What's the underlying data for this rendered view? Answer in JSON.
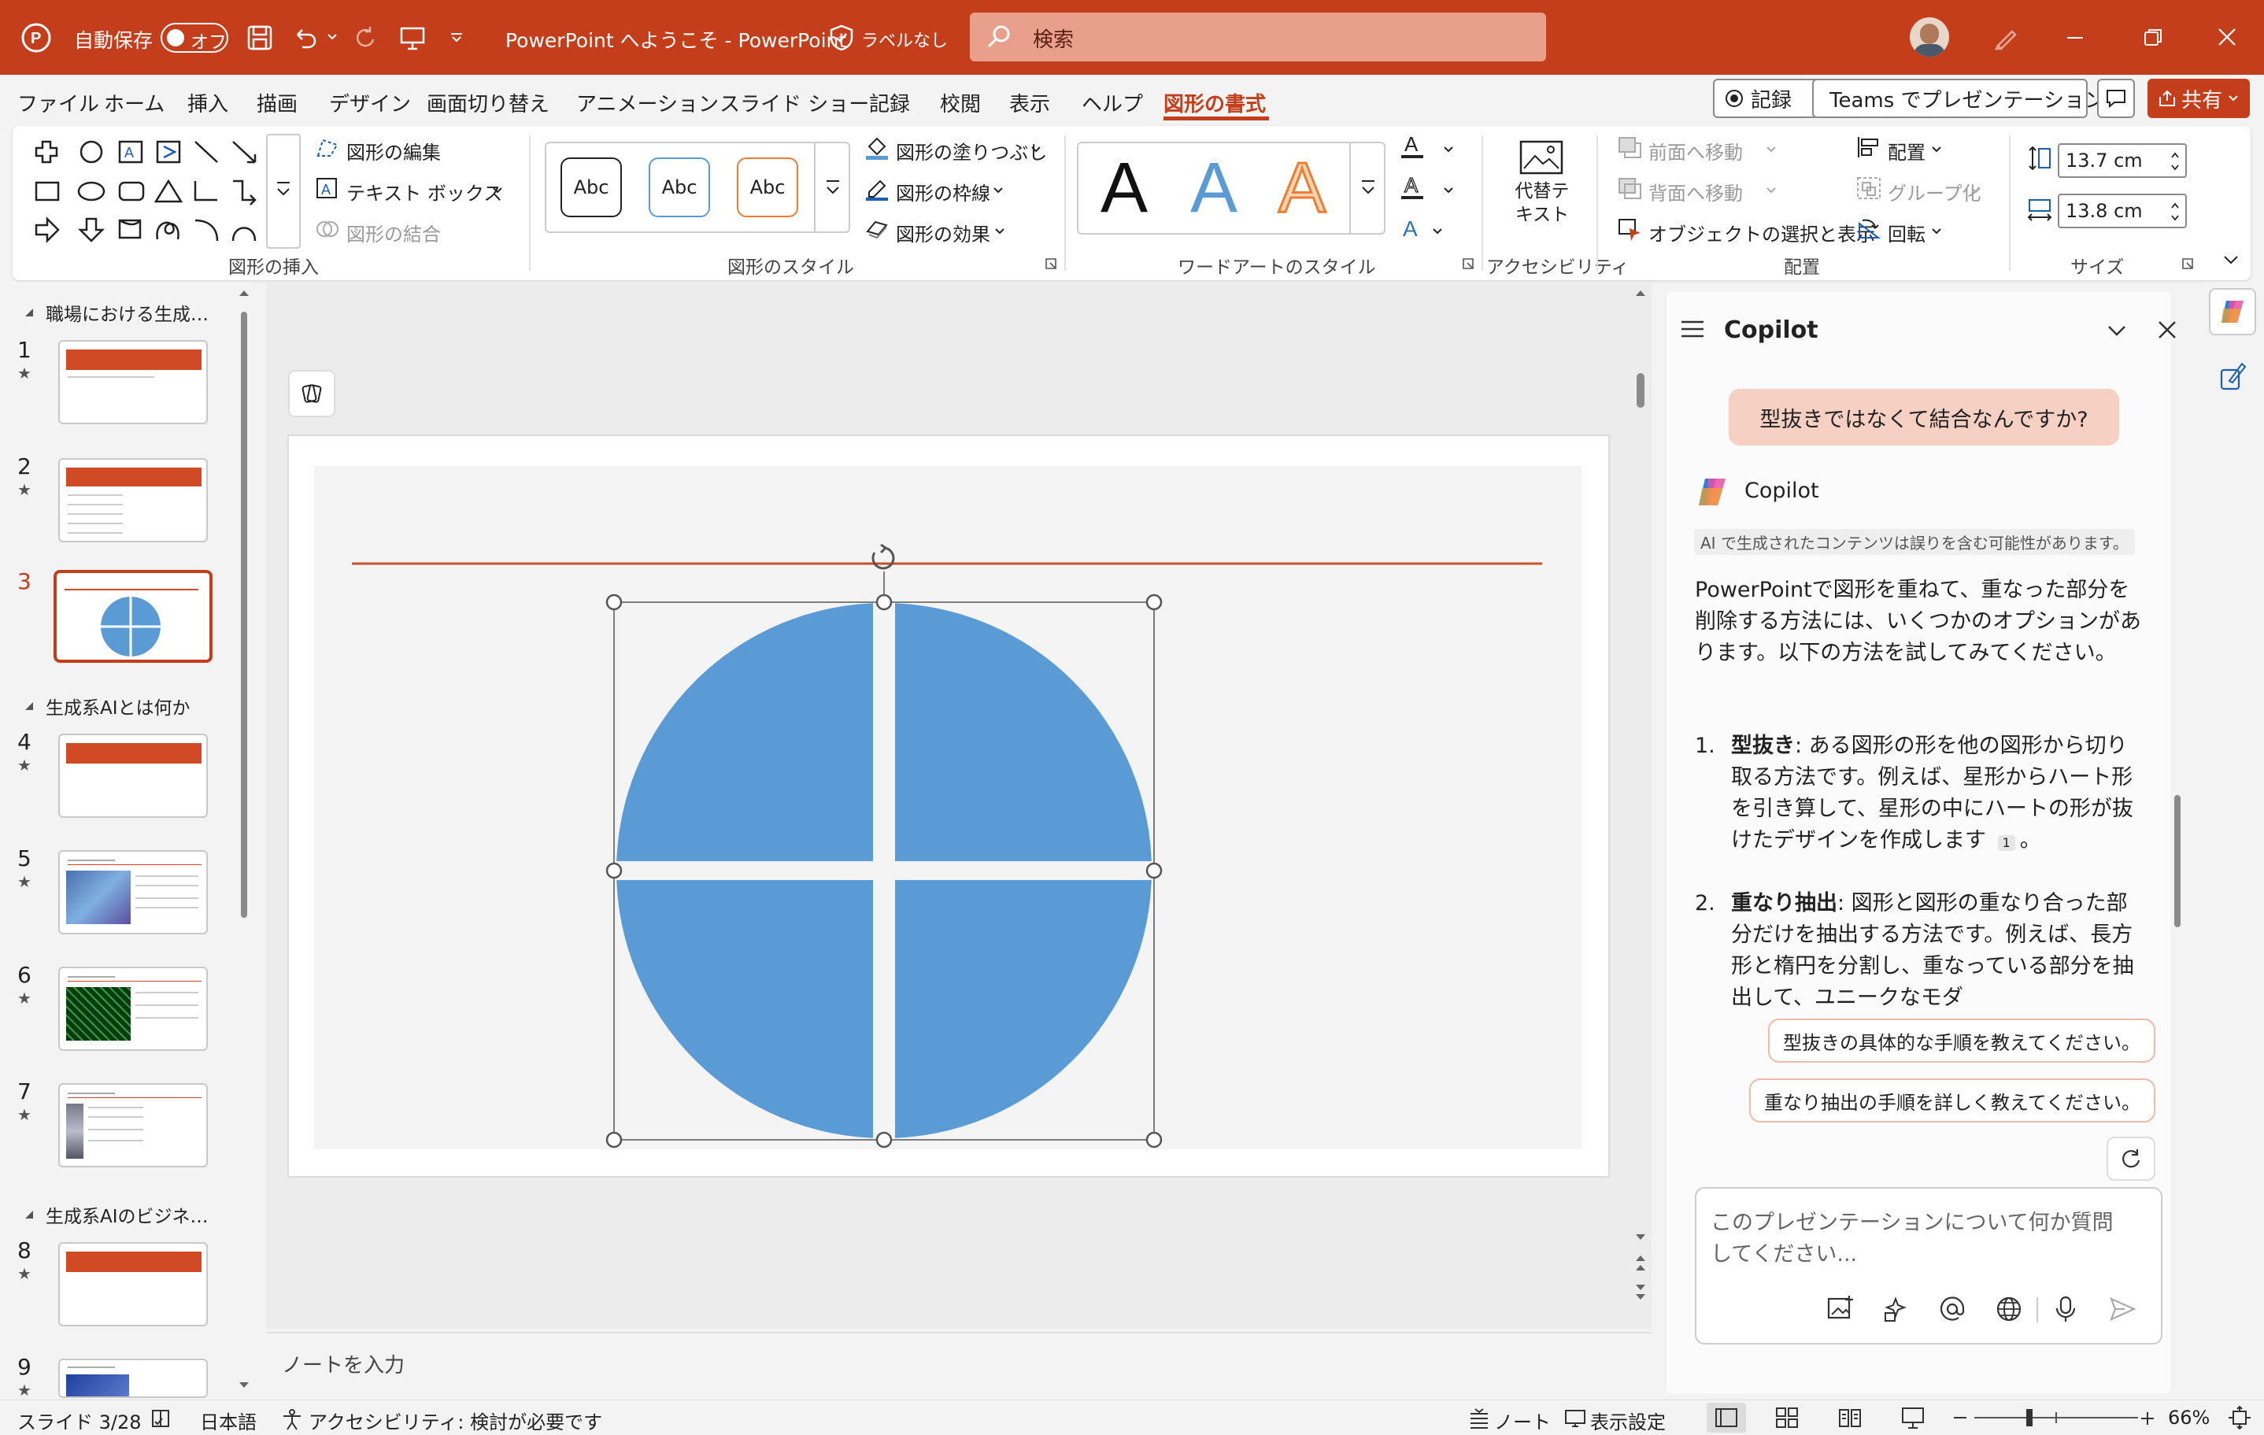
{
  "titlebar": {
    "autosave_label": "自動保存",
    "autosave_state": "オフ",
    "doc_title": "PowerPoint へようこそ  -  PowerPoint",
    "label_text": "ラベルなし",
    "search_placeholder": "検索"
  },
  "menu": {
    "items": [
      "ファイル",
      "ホーム",
      "挿入",
      "描画",
      "デザイン",
      "画面切り替え",
      "アニメーション",
      "スライド ショー",
      "記録",
      "校閲",
      "表示",
      "ヘルプ",
      "図形の書式"
    ],
    "active": "図形の書式",
    "record_button": "記録",
    "teams_button": "Teams でプレゼンテーション",
    "share_button": "共有"
  },
  "ribbon": {
    "insert_shapes": {
      "label": "図形の挿入",
      "edit_shape": "図形の編集",
      "text_box": "テキスト ボックス",
      "merge_shapes": "図形の結合"
    },
    "shape_styles": {
      "label": "図形のスタイル",
      "sample": "Abc",
      "fill": "図形の塗りつぶし",
      "outline": "図形の枠線",
      "effects": "図形の効果"
    },
    "wordart": {
      "label": "ワードアートのスタイル",
      "letter": "A"
    },
    "accessibility": {
      "label": "アクセシビリティ",
      "alt_text_line1": "代替テ",
      "alt_text_line2": "キスト"
    },
    "arrange": {
      "label": "配置",
      "bring_forward": "前面へ移動",
      "send_backward": "背面へ移動",
      "selection_pane": "オブジェクトの選択と表示",
      "align": "配置",
      "group": "グループ化",
      "rotate": "回転"
    },
    "size": {
      "label": "サイズ",
      "height": "13.7 cm",
      "width": "13.8 cm"
    }
  },
  "thumbnails": {
    "sections": [
      "職場における生成…",
      "生成系AIとは何か",
      "生成系AIのビジネ…"
    ],
    "slides": [
      "1",
      "2",
      "3",
      "4",
      "5",
      "6",
      "7",
      "8",
      "9"
    ],
    "current": "3"
  },
  "notes_placeholder": "ノートを入力",
  "colors": {
    "accent": "#c43e1c",
    "shape_fill": "#5b9bd5",
    "title_line": "#c8502a"
  },
  "copilot": {
    "title": "Copilot",
    "user_message": "型抜きではなくて結合なんですか?",
    "assistant_name": "Copilot",
    "disclaimer": "AI で生成されたコンテンツは誤りを含む可能性があります。",
    "intro": "PowerPointで図形を重ねて、重なった部分を削除する方法には、いくつかのオプションがあります。以下の方法を試してみてください。",
    "items": [
      {
        "num": "1.",
        "term": "型抜き",
        "text": ": ある図形の形を他の図形から切り取る方法です。例えば、星形からハート形を引き算して、星形の中にハートの形が抜けたデザインを作成します",
        "cite": "1",
        "end": "。"
      },
      {
        "num": "2.",
        "term": "重なり抽出",
        "text": ": 図形と図形の重なり合った部分だけを抽出する方法です。例えば、長方形と楕円を分割し、重なっている部分を抽出して、ユニークなモダ"
      }
    ],
    "suggestions": [
      "型抜きの具体的な手順を教えてください。",
      "重なり抽出の手順を詳しく教えてください。"
    ],
    "input_placeholder_line1": "このプレゼンテーションについて何か質問",
    "input_placeholder_line2": "してください..."
  },
  "statusbar": {
    "slide_counter": "スライド 3/28",
    "language": "日本語",
    "accessibility": "アクセシビリティ: 検討が必要です",
    "notes": "ノート",
    "display_settings": "表示設定",
    "zoom": "66%"
  }
}
